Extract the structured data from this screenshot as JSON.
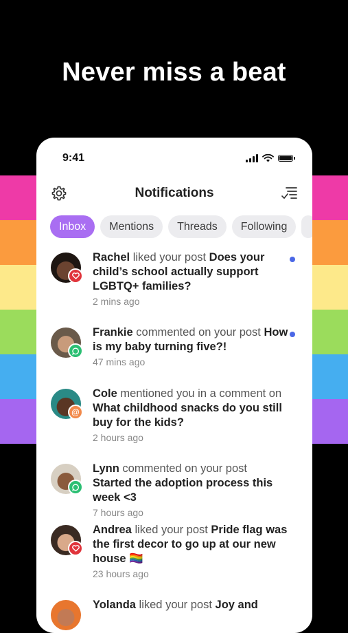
{
  "headline": "Never miss a beat",
  "colors": {
    "stripes": [
      "#ee3aa7",
      "#fb9b3e",
      "#fde98a",
      "#9bdc5c",
      "#45aef0",
      "#a566f0"
    ],
    "accent": "#a96ef2",
    "unread_dot": "#4a67e6"
  },
  "status_bar": {
    "time": "9:41",
    "icons": [
      "signal-icon",
      "wifi-icon",
      "battery-icon"
    ]
  },
  "header": {
    "title": "Notifications",
    "left_icon": "gear-icon",
    "right_icon": "filter-icon"
  },
  "tabs": [
    {
      "label": "Inbox",
      "active": true
    },
    {
      "label": "Mentions",
      "active": false
    },
    {
      "label": "Threads",
      "active": false
    },
    {
      "label": "Following",
      "active": false
    }
  ],
  "notifications": [
    {
      "name": "Rachel",
      "verb": " liked your post ",
      "post": "Does your child’s school actually support LGBTQ+ families?",
      "time": "2 mins ago",
      "badge": "heart-badge-icon",
      "badge_color": "#e0353c",
      "unread": true
    },
    {
      "name": "Frankie",
      "verb": " commented on your post ",
      "post": "How is my baby turning five?!",
      "time": "47 mins ago",
      "badge": "comment-badge-icon",
      "badge_color": "#2bbf73",
      "unread": true
    },
    {
      "name": "Cole",
      "verb": " mentioned you in a comment on ",
      "post": "What childhood snacks do you still buy for the kids?",
      "time": "2 hours ago",
      "badge": "mention-badge-icon",
      "badge_color": "#f28a4b",
      "unread": false
    },
    {
      "name": "Lynn",
      "verb": " commented on your post ",
      "post": "Started the adoption process this week <3",
      "time": "7 hours ago",
      "badge": "comment-badge-icon",
      "badge_color": "#2bbf73",
      "unread": false
    },
    {
      "name": "Andrea",
      "verb": " liked your post ",
      "post": "Pride flag was the first decor to go up at our new house 🏳️‍🌈",
      "time": "23 hours ago",
      "badge": "heart-badge-icon",
      "badge_color": "#e0353c",
      "unread": false
    },
    {
      "name": "Yolanda",
      "verb": " liked your post ",
      "post": "Joy and",
      "time": "",
      "badge": "heart-badge-icon",
      "badge_color": "#e0353c",
      "unread": false
    }
  ]
}
